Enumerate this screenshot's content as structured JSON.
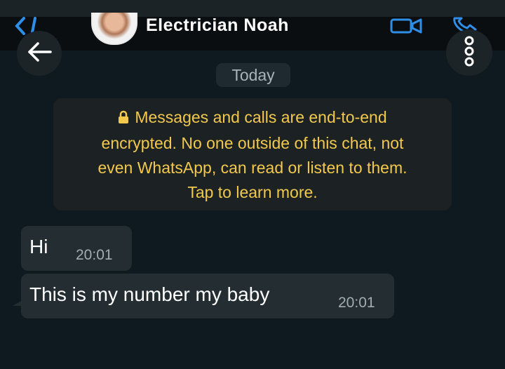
{
  "header": {
    "contact_name": "Electrician Noah"
  },
  "chat": {
    "date_divider": "Today",
    "encryption_notice": {
      "lines": [
        "Messages and calls are end-to-end",
        "encrypted. No one outside of this chat, not",
        "even WhatsApp, can read or listen to them.",
        "Tap to learn more."
      ]
    },
    "messages": [
      {
        "text": "Hi",
        "time": "20:01"
      },
      {
        "text": "This is my number my baby",
        "time": "20:01"
      }
    ]
  },
  "icons": {
    "header_back": "back-chevron-icon",
    "video_call": "video-call-icon",
    "voice_call": "phone-icon",
    "overlay_back": "arrow-left-icon",
    "overlay_menu": "more-vertical-icon",
    "lock": "lock-icon"
  },
  "colors": {
    "accent_blue": "#2f8fe8",
    "notice_yellow": "#f2c94c",
    "bubble_bg": "#232d32",
    "chat_bg": "#0f1a20"
  }
}
